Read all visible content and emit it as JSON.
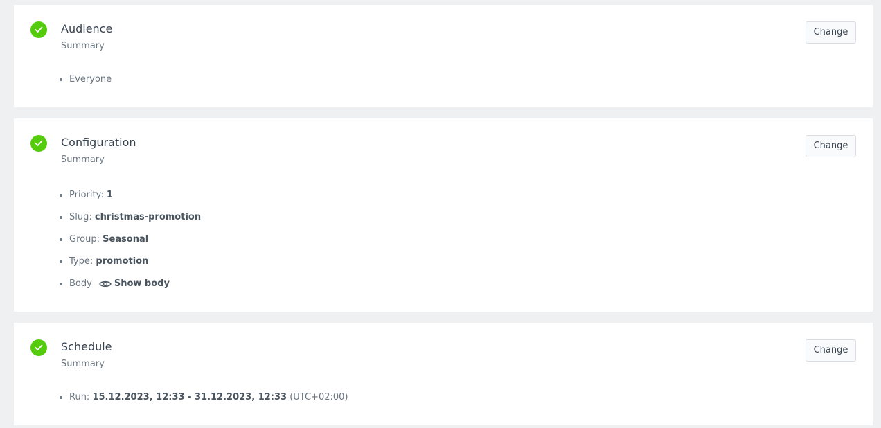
{
  "cards": {
    "audience": {
      "title": "Audience",
      "subtitle": "Summary",
      "change_label": "Change",
      "items": [
        "Everyone"
      ]
    },
    "configuration": {
      "title": "Configuration",
      "subtitle": "Summary",
      "change_label": "Change",
      "priority": {
        "label": "Priority: ",
        "value": "1"
      },
      "slug": {
        "label": "Slug: ",
        "value": "christmas-promotion"
      },
      "group": {
        "label": "Group: ",
        "value": "Seasonal"
      },
      "type": {
        "label": "Type: ",
        "value": "promotion"
      },
      "body": {
        "label": "Body",
        "action": "Show body",
        "icon": "eye-icon"
      }
    },
    "schedule": {
      "title": "Schedule",
      "subtitle": "Summary",
      "change_label": "Change",
      "run": {
        "label": "Run: ",
        "value": "15.12.2023, 12:33 - 31.12.2023, 12:33",
        "timezone": "(UTC+02:00)"
      }
    }
  },
  "colors": {
    "success": "#54cb0b",
    "background": "#eef0f2",
    "card": "#ffffff",
    "text": "#384350",
    "muted": "#6a7580"
  }
}
